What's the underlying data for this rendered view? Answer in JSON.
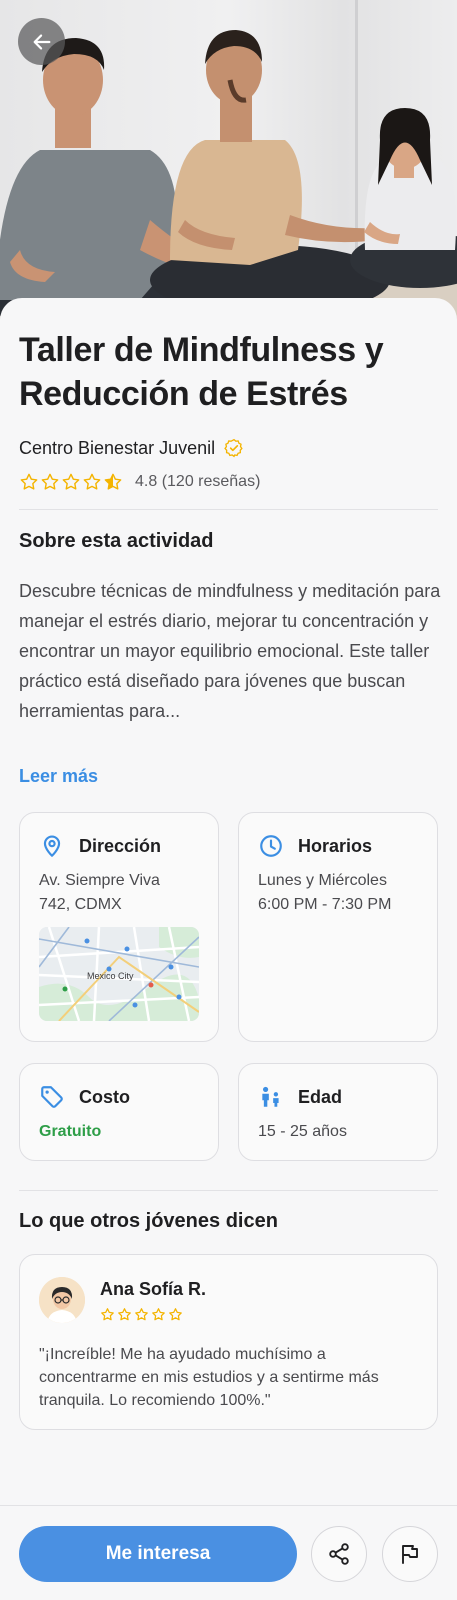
{
  "activity": {
    "title": "Taller de Mindfulness y Reducción de Estrés",
    "organizer": "Centro Bienestar Juvenil",
    "rating_text": "4.8 (120 reseñas)",
    "rating_value": 4.8,
    "rating_max": 5
  },
  "about": {
    "heading": "Sobre esta actividad",
    "description": "Descubre técnicas de mindfulness y meditación para manejar el estrés diario, mejorar tu concentración y encontrar un mayor equilibrio emocional. Este taller práctico está diseñado para jóvenes que buscan herramientas para...",
    "read_more": "Leer más"
  },
  "info": {
    "address": {
      "label": "Dirección",
      "line1": "Av. Siempre Viva",
      "line2": "742, CDMX",
      "map_label": "Mexico City",
      "icon": "location-pin-icon"
    },
    "schedule": {
      "label": "Horarios",
      "line1": "Lunes y Miércoles",
      "line2": "6:00 PM - 7:30 PM",
      "icon": "clock-icon"
    },
    "cost": {
      "label": "Costo",
      "value": "Gratuito",
      "icon": "tag-icon"
    },
    "age": {
      "label": "Edad",
      "value": "15 - 25 años",
      "icon": "people-icon"
    }
  },
  "reviews": {
    "heading": "Lo que otros jóvenes dicen",
    "items": [
      {
        "name": "Ana Sofía R.",
        "stars": 5,
        "text": "\"¡Increíble! Me ha ayudado muchísimo a concentrarme en mis estudios y a sentirme más tranquila. Lo recomiendo 100%.\""
      }
    ]
  },
  "actions": {
    "primary_label": "Me interesa",
    "share_icon": "share-icon",
    "report_icon": "flag-icon",
    "back_icon": "arrow-left-icon"
  },
  "colors": {
    "accent": "#4a90e2",
    "link": "#3b8ee3",
    "star": "#f4b400",
    "free": "#2e9e48",
    "verified": "#f4b400"
  }
}
